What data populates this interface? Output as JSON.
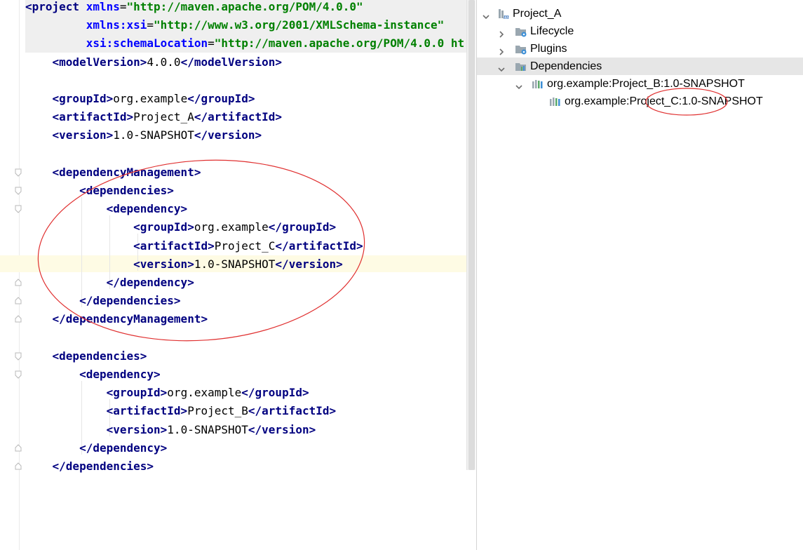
{
  "editor": {
    "lines": [
      {
        "parts": [
          [
            "tag",
            "<project "
          ],
          [
            "attr",
            "xmlns"
          ],
          [
            "txt",
            "="
          ],
          [
            "val",
            "\"http://maven.apache.org/POM/4.0.0\""
          ]
        ]
      },
      {
        "parts": [
          [
            "txt",
            "         "
          ],
          [
            "attr",
            "xmlns:xsi"
          ],
          [
            "txt",
            "="
          ],
          [
            "val",
            "\"http://www.w3.org/2001/XMLSchema-instance\""
          ]
        ]
      },
      {
        "parts": [
          [
            "txt",
            "         "
          ],
          [
            "attr",
            "xsi:schemaLocation"
          ],
          [
            "txt",
            "="
          ],
          [
            "val",
            "\"http://maven.apache.org/POM/4.0.0 ht"
          ]
        ]
      },
      {
        "parts": [
          [
            "txt",
            "    "
          ],
          [
            "tag",
            "<modelVersion>"
          ],
          [
            "txt",
            "4.0.0"
          ],
          [
            "tag",
            "</modelVersion>"
          ]
        ]
      },
      {
        "parts": []
      },
      {
        "parts": [
          [
            "txt",
            "    "
          ],
          [
            "tag",
            "<groupId>"
          ],
          [
            "txt",
            "org.example"
          ],
          [
            "tag",
            "</groupId>"
          ]
        ]
      },
      {
        "parts": [
          [
            "txt",
            "    "
          ],
          [
            "tag",
            "<artifactId>"
          ],
          [
            "txt",
            "Project_A"
          ],
          [
            "tag",
            "</artifactId>"
          ]
        ]
      },
      {
        "parts": [
          [
            "txt",
            "    "
          ],
          [
            "tag",
            "<version>"
          ],
          [
            "txt",
            "1.0-SNAPSHOT"
          ],
          [
            "tag",
            "</version>"
          ]
        ]
      },
      {
        "parts": []
      },
      {
        "parts": [
          [
            "txt",
            "    "
          ],
          [
            "tag",
            "<dependencyManagement>"
          ]
        ]
      },
      {
        "parts": [
          [
            "txt",
            "        "
          ],
          [
            "tag",
            "<dependencies>"
          ]
        ]
      },
      {
        "parts": [
          [
            "txt",
            "            "
          ],
          [
            "tag",
            "<dependency>"
          ]
        ]
      },
      {
        "parts": [
          [
            "txt",
            "                "
          ],
          [
            "tag",
            "<groupId>"
          ],
          [
            "txt",
            "org.example"
          ],
          [
            "tag",
            "</groupId>"
          ]
        ]
      },
      {
        "parts": [
          [
            "txt",
            "                "
          ],
          [
            "tag",
            "<artifactId>"
          ],
          [
            "txt",
            "Project_C"
          ],
          [
            "tag",
            "</artifactId>"
          ]
        ]
      },
      {
        "parts": [
          [
            "txt",
            "                "
          ],
          [
            "tag",
            "<version>"
          ],
          [
            "txt",
            "1.0-SNAPSHOT"
          ],
          [
            "tag",
            "</version>"
          ]
        ]
      },
      {
        "parts": [
          [
            "txt",
            "            "
          ],
          [
            "tag",
            "</dependency>"
          ]
        ]
      },
      {
        "parts": [
          [
            "txt",
            "        "
          ],
          [
            "tag",
            "</dependencies>"
          ]
        ]
      },
      {
        "parts": [
          [
            "txt",
            "    "
          ],
          [
            "tag",
            "</dependencyManagement>"
          ]
        ]
      },
      {
        "parts": []
      },
      {
        "parts": [
          [
            "txt",
            "    "
          ],
          [
            "tag",
            "<dependencies>"
          ]
        ]
      },
      {
        "parts": [
          [
            "txt",
            "        "
          ],
          [
            "tag",
            "<dependency>"
          ]
        ]
      },
      {
        "parts": [
          [
            "txt",
            "            "
          ],
          [
            "tag",
            "<groupId>"
          ],
          [
            "txt",
            "org.example"
          ],
          [
            "tag",
            "</groupId>"
          ]
        ]
      },
      {
        "parts": [
          [
            "txt",
            "            "
          ],
          [
            "tag",
            "<artifactId>"
          ],
          [
            "txt",
            "Project_B"
          ],
          [
            "tag",
            "</artifactId>"
          ]
        ]
      },
      {
        "parts": [
          [
            "txt",
            "            "
          ],
          [
            "tag",
            "<version>"
          ],
          [
            "txt",
            "1.0-SNAPSHOT"
          ],
          [
            "tag",
            "</version>"
          ]
        ]
      },
      {
        "parts": [
          [
            "txt",
            "        "
          ],
          [
            "tag",
            "</dependency>"
          ]
        ]
      },
      {
        "parts": [
          [
            "txt",
            "    "
          ],
          [
            "tag",
            "</dependencies>"
          ]
        ]
      }
    ]
  },
  "maven_tree": {
    "root": {
      "label": "Project_A",
      "icon": "maven-module-icon"
    },
    "items": [
      {
        "label": "Lifecycle",
        "icon": "lifecycle-folder-icon",
        "arrow": "collapsed"
      },
      {
        "label": "Plugins",
        "icon": "plugins-folder-icon",
        "arrow": "collapsed"
      },
      {
        "label": "Dependencies",
        "icon": "dependencies-folder-icon",
        "arrow": "expanded",
        "selected": true
      },
      {
        "label": "org.example:Project_B:1.0-SNAPSHOT",
        "icon": "library-icon",
        "arrow": "expanded"
      },
      {
        "label": "org.example:Project_C:1.0-SNAPSHOT",
        "icon": "library-icon",
        "arrow": "none"
      }
    ]
  },
  "colors": {
    "tag": "#000080",
    "attribute": "#0000ff",
    "value": "#008000",
    "annotation": "#e03030",
    "selection": "#e6e6e6"
  }
}
